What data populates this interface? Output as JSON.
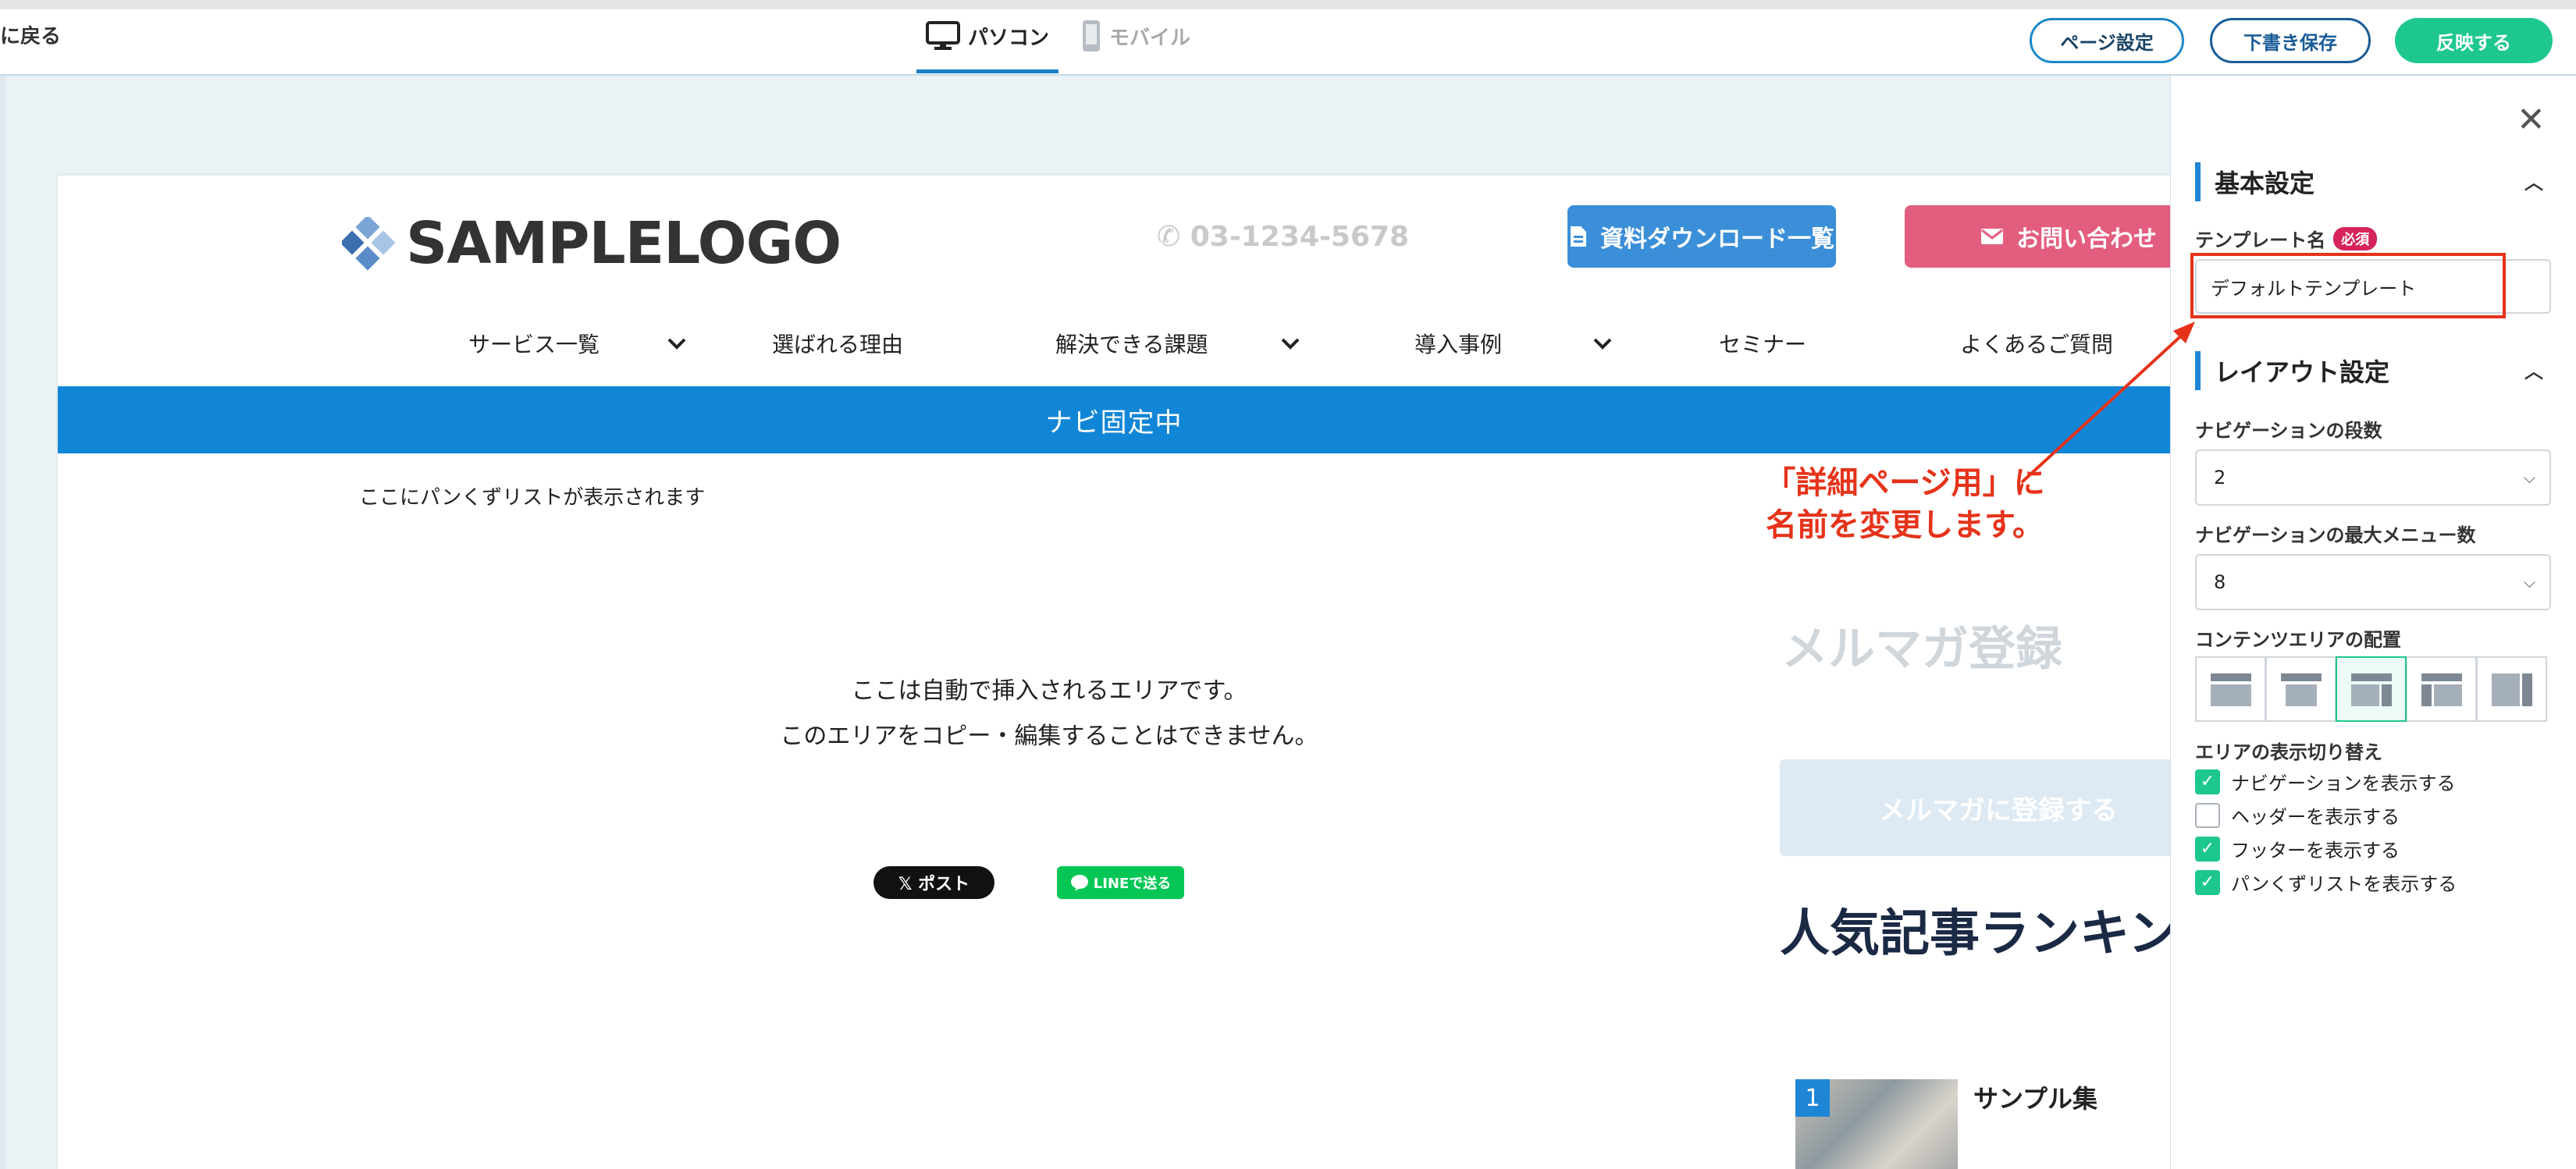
{
  "topbar": {
    "back_label": "に戻る",
    "device_tabs": [
      {
        "label": "パソコン",
        "icon": "monitor-icon",
        "active": true
      },
      {
        "label": "モバイル",
        "icon": "smartphone-icon",
        "active": false
      }
    ],
    "page_settings_label": "ページ設定",
    "save_draft_label": "下書き保存",
    "apply_label": "反映する",
    "accent_color": "#1ec88c"
  },
  "preview": {
    "logo_text": "SAMPLELOGO",
    "phone": "03-1234-5678",
    "download_button": "資料ダウンロード一覧",
    "contact_button": "お問い合わせ",
    "nav_items": [
      {
        "label": "サービス一覧",
        "dropdown": true
      },
      {
        "label": "選ばれる理由",
        "dropdown": false
      },
      {
        "label": "解決できる課題",
        "dropdown": true
      },
      {
        "label": "導入事例",
        "dropdown": true
      },
      {
        "label": "セミナー",
        "dropdown": false
      },
      {
        "label": "よくあるご質問",
        "dropdown": false
      }
    ],
    "nav_fixed_bar": "ナビ固定中",
    "breadcrumb_placeholder": "ここにパンくずリストが表示されます",
    "auto_area_line1": "ここは自動で挿入されるエリアです。",
    "auto_area_line2": "このエリアをコピー・編集することはできません。",
    "share_x": "𝕏 ポスト",
    "share_line": "LINEで送る",
    "sidebar": {
      "newsletter_title": "メルマガ登録",
      "newsletter_button": "メルマガに登録する",
      "ranking_title": "人気記事ランキング",
      "ranking_items": [
        {
          "rank": "1",
          "title": "サンプル集"
        }
      ]
    }
  },
  "annotation": {
    "line1": "「詳細ページ用」に",
    "line2": "名前を変更します。",
    "color": "#e5331a"
  },
  "panel": {
    "basic_section": "基本設定",
    "template_name_label": "テンプレート名",
    "required_badge": "必須",
    "template_name_value": "デフォルトテンプレート",
    "layout_section": "レイアウト設定",
    "nav_rows_label": "ナビゲーションの段数",
    "nav_rows_value": "2",
    "nav_max_label": "ナビゲーションの最大メニュー数",
    "nav_max_value": "8",
    "content_layout_label": "コンテンツエリアの配置",
    "content_layout_selected_index": 2,
    "toggle_label": "エリアの表示切り替え",
    "toggles": [
      {
        "label": "ナビゲーションを表示する",
        "checked": true
      },
      {
        "label": "ヘッダーを表示する",
        "checked": false
      },
      {
        "label": "フッターを表示する",
        "checked": true
      },
      {
        "label": "パンくずリストを表示する",
        "checked": true
      }
    ]
  }
}
